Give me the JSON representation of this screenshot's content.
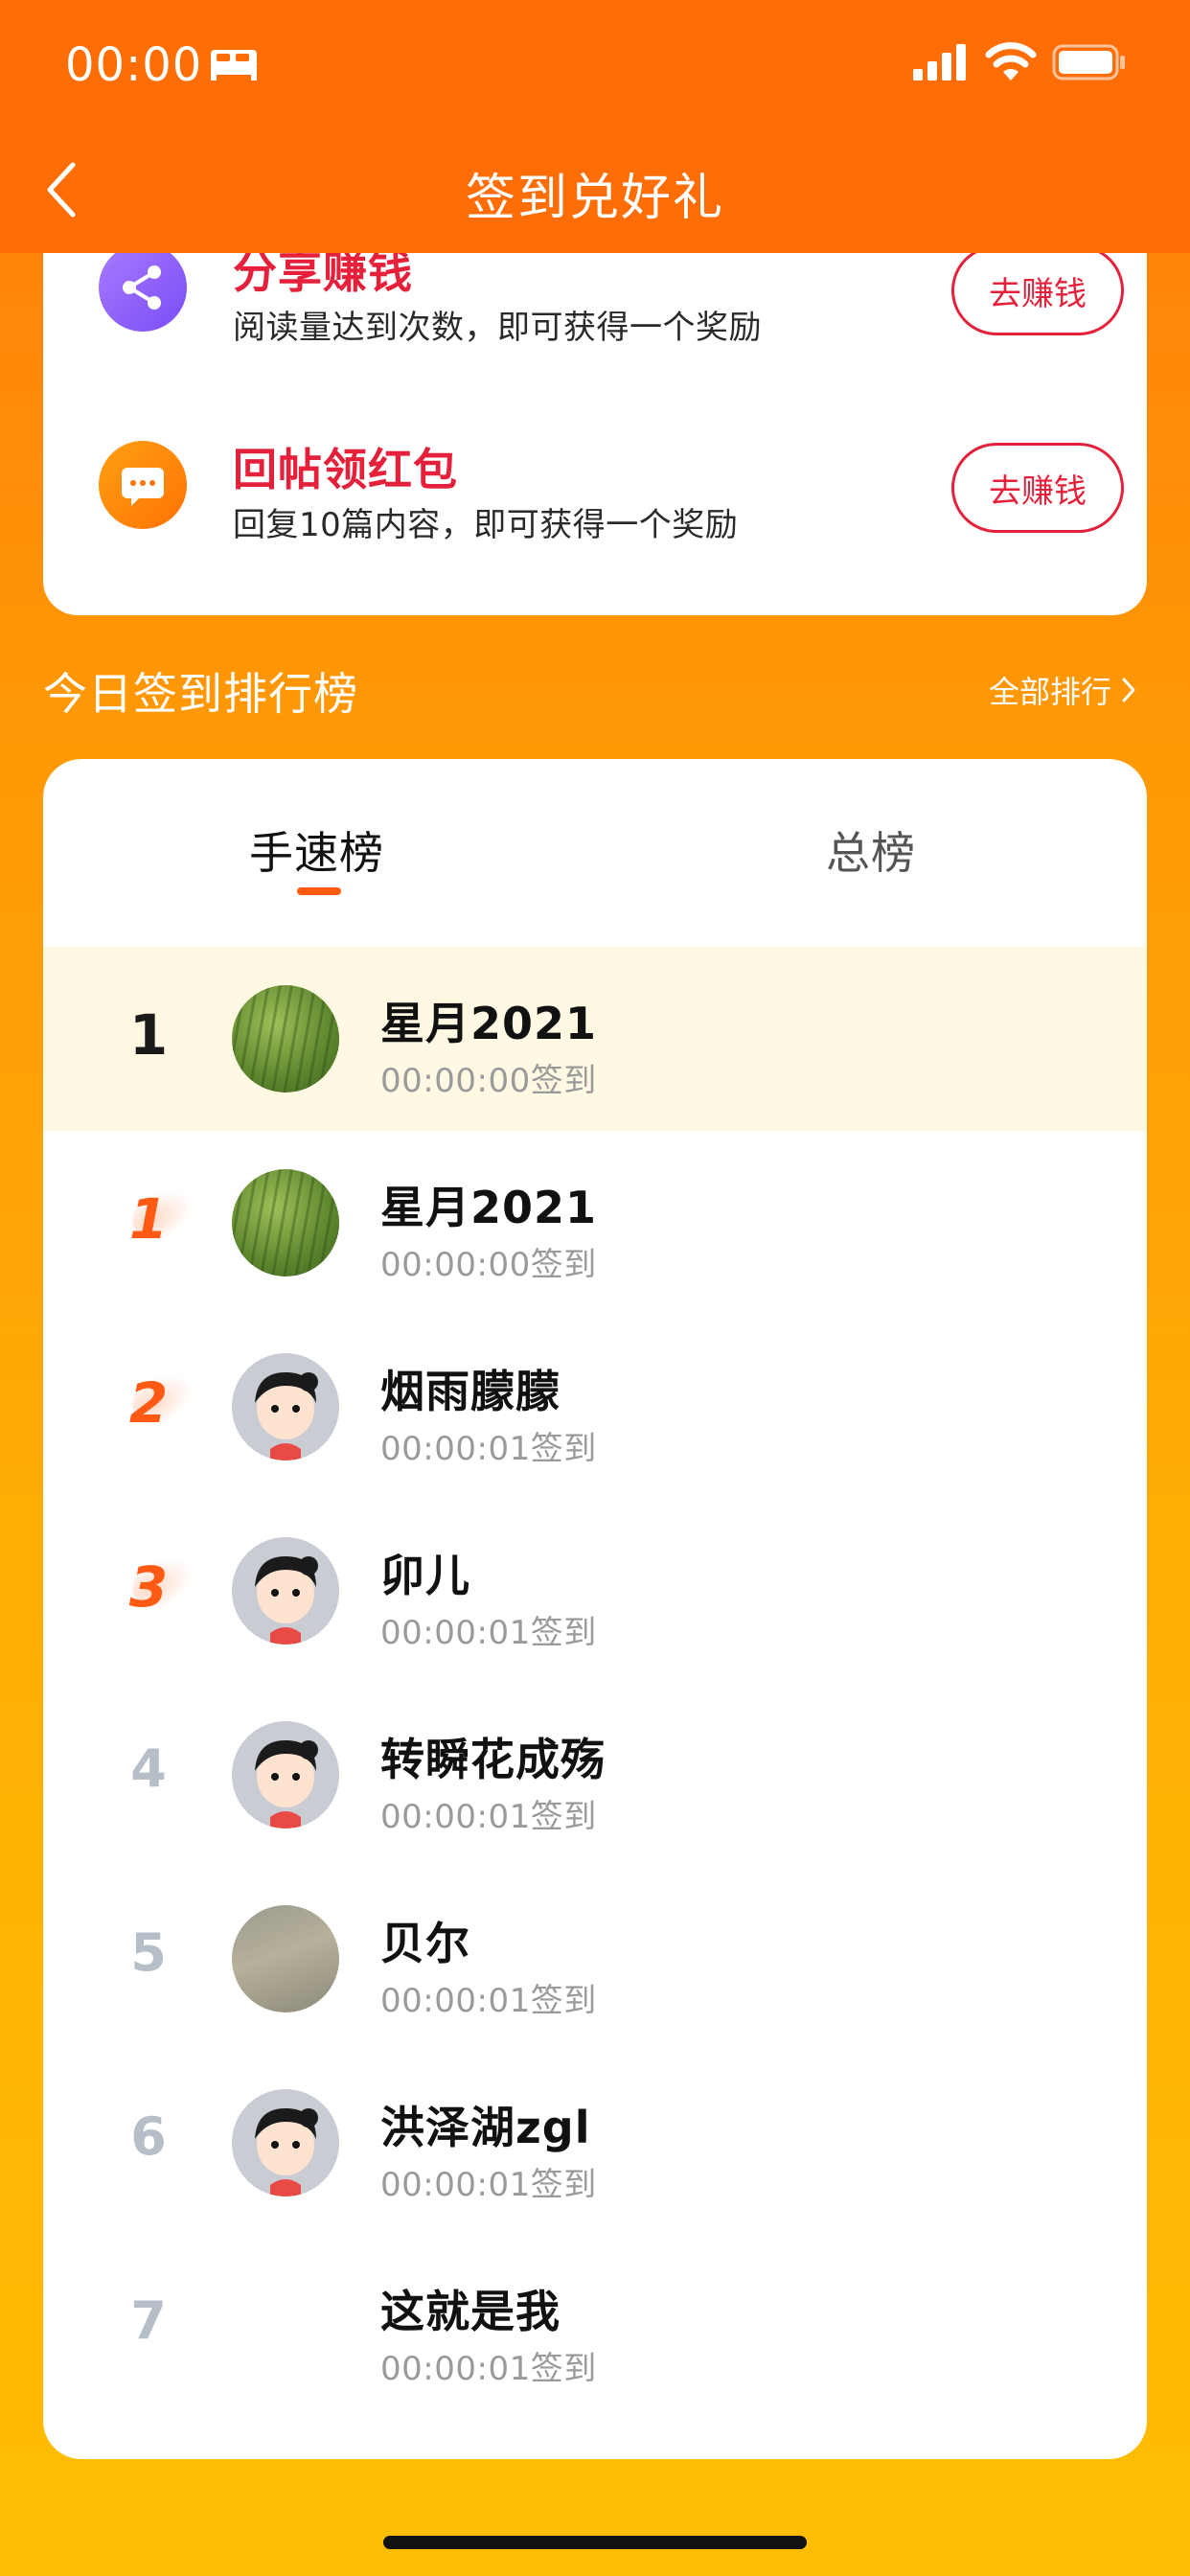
{
  "status": {
    "time": "00:00"
  },
  "nav": {
    "title": "签到兑好礼"
  },
  "tasks": [
    {
      "title": "分享赚钱",
      "desc": "阅读量达到次数，即可获得一个奖励",
      "button": "去赚钱",
      "icon": "share-icon",
      "color": "#7a4cf5"
    },
    {
      "title": "回帖领红包",
      "desc": "回复10篇内容，即可获得一个奖励",
      "button": "去赚钱",
      "icon": "chat-icon",
      "color": "#ff7205"
    }
  ],
  "ranking": {
    "title": "今日签到排行榜",
    "view_all": "全部排行",
    "tabs": [
      "手速榜",
      "总榜"
    ],
    "active_tab": "手速榜",
    "rows": [
      {
        "rank": "1",
        "name": "星月2021",
        "time": "00:00:00签到",
        "avatar": "grass-photo",
        "style": "top"
      },
      {
        "rank": "1",
        "name": "星月2021",
        "time": "00:00:00签到",
        "avatar": "grass-photo",
        "style": "medal"
      },
      {
        "rank": "2",
        "name": "烟雨朦朦",
        "time": "00:00:01签到",
        "avatar": "cartoon-girl",
        "style": "medal"
      },
      {
        "rank": "3",
        "name": "卯儿",
        "time": "00:00:01签到",
        "avatar": "cartoon-girl",
        "style": "medal"
      },
      {
        "rank": "4",
        "name": "转瞬花成殇",
        "time": "00:00:01签到",
        "avatar": "cartoon-girl",
        "style": "plain"
      },
      {
        "rank": "5",
        "name": "贝尔",
        "time": "00:00:01签到",
        "avatar": "road-photo",
        "style": "plain"
      },
      {
        "rank": "6",
        "name": "洪泽湖zgl",
        "time": "00:00:01签到",
        "avatar": "cartoon-girl",
        "style": "plain"
      },
      {
        "rank": "7",
        "name": "这就是我",
        "time": "00:00:01签到",
        "avatar": "none",
        "style": "plain"
      }
    ]
  },
  "colors": {
    "header": "#ff6d07",
    "accent_red": "#e5203a",
    "accent_orange": "#ff5a13",
    "highlight_row": "#fff8e3"
  }
}
